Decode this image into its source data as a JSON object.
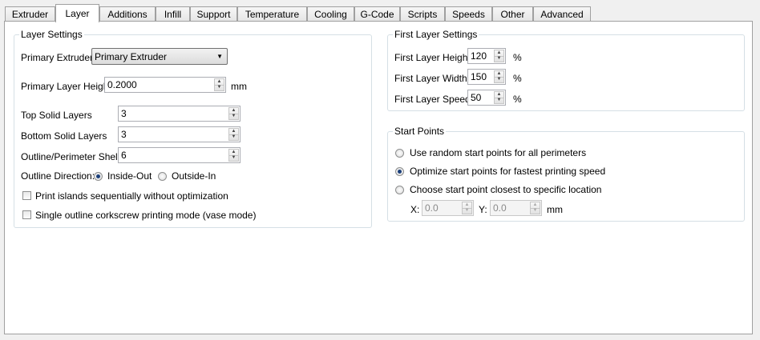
{
  "tabs": [
    "Extruder",
    "Layer",
    "Additions",
    "Infill",
    "Support",
    "Temperature",
    "Cooling",
    "G-Code",
    "Scripts",
    "Speeds",
    "Other",
    "Advanced"
  ],
  "active_tab": "Layer",
  "layer_settings": {
    "title": "Layer Settings",
    "primary_extruder_label": "Primary Extruder",
    "primary_extruder_value": "Primary Extruder",
    "primary_layer_height_label": "Primary Layer Height",
    "primary_layer_height_value": "0.2000",
    "primary_layer_height_unit": "mm",
    "top_solid_label": "Top Solid Layers",
    "top_solid_value": "3",
    "bottom_solid_label": "Bottom Solid Layers",
    "bottom_solid_value": "3",
    "shells_label": "Outline/Perimeter Shells",
    "shells_value": "6",
    "direction_label": "Outline Direction:",
    "direction_inside": "Inside-Out",
    "direction_outside": "Outside-In",
    "direction_selected": "Inside-Out",
    "print_islands_label": "Print islands sequentially without optimization",
    "print_islands_checked": false,
    "vase_mode_label": "Single outline corkscrew printing mode (vase mode)",
    "vase_mode_checked": false
  },
  "first_layer": {
    "title": "First Layer Settings",
    "height_label": "First Layer Height",
    "height_value": "120",
    "width_label": "First Layer Width",
    "width_value": "150",
    "speed_label": "First Layer Speed",
    "speed_value": "50",
    "unit": "%"
  },
  "start_points": {
    "title": "Start Points",
    "option_random": "Use random start points for all perimeters",
    "option_optimize": "Optimize start points for fastest printing speed",
    "option_closest": "Choose start point closest to specific location",
    "selected": "optimize",
    "x_label": "X:",
    "x_value": "0.0",
    "y_label": "Y:",
    "y_value": "0.0",
    "unit": "mm"
  }
}
